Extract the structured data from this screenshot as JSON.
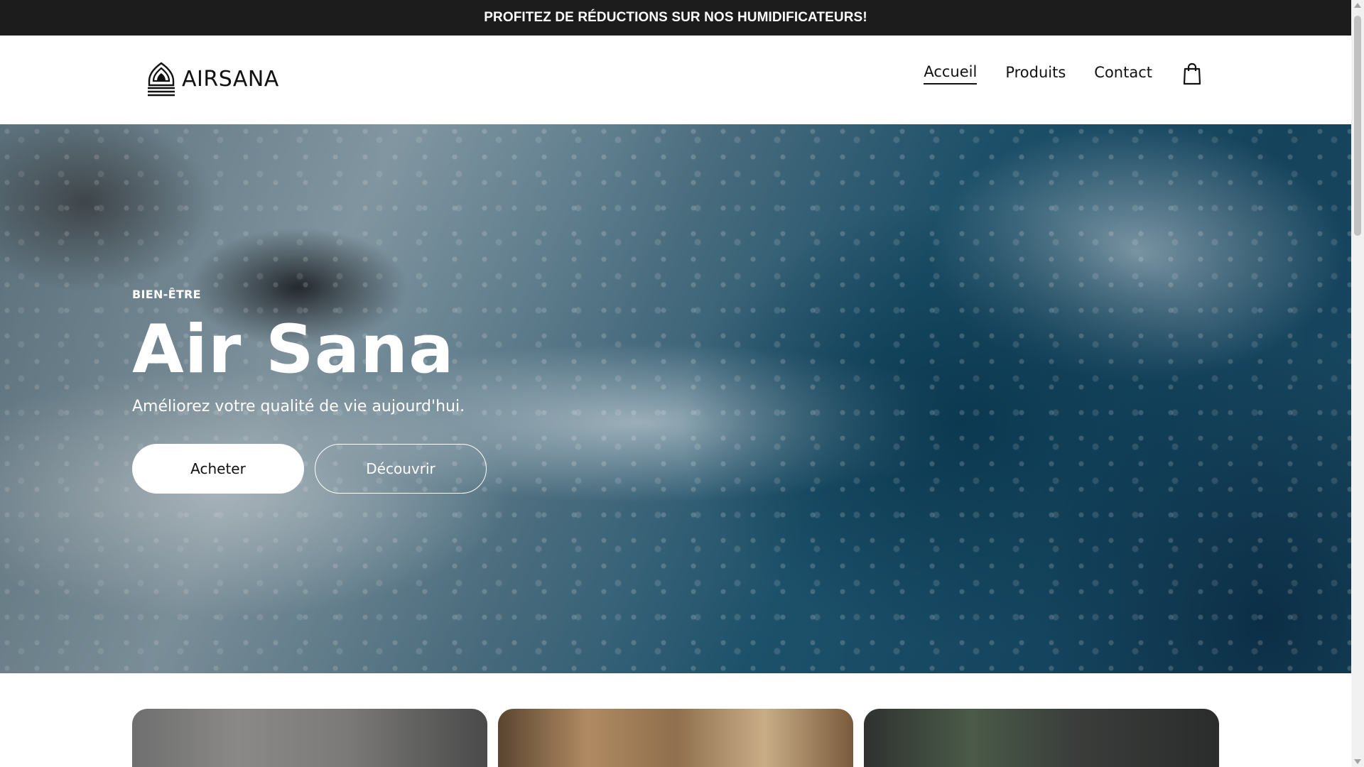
{
  "announcement": {
    "text": "PROFITEZ DE RÉDUCTIONS SUR NOS HUMIDIFICATEURS!"
  },
  "header": {
    "brand": "AIRSANA",
    "logo_icon": "lotus-dome-icon",
    "nav": [
      {
        "label": "Accueil",
        "active": true
      },
      {
        "label": "Produits",
        "active": false
      },
      {
        "label": "Contact",
        "active": false
      }
    ],
    "cart_icon": "shopping-bag-icon"
  },
  "hero": {
    "eyebrow": "BIEN-ÊTRE",
    "title": "Air Sana",
    "subtitle": "Améliorez votre qualité de vie aujourd'hui.",
    "primary_button": "Acheter",
    "secondary_button": "Découvrir"
  },
  "colors": {
    "announcement_bg": "#1c1c1c",
    "text": "#111111",
    "hero_text": "#ffffff"
  }
}
